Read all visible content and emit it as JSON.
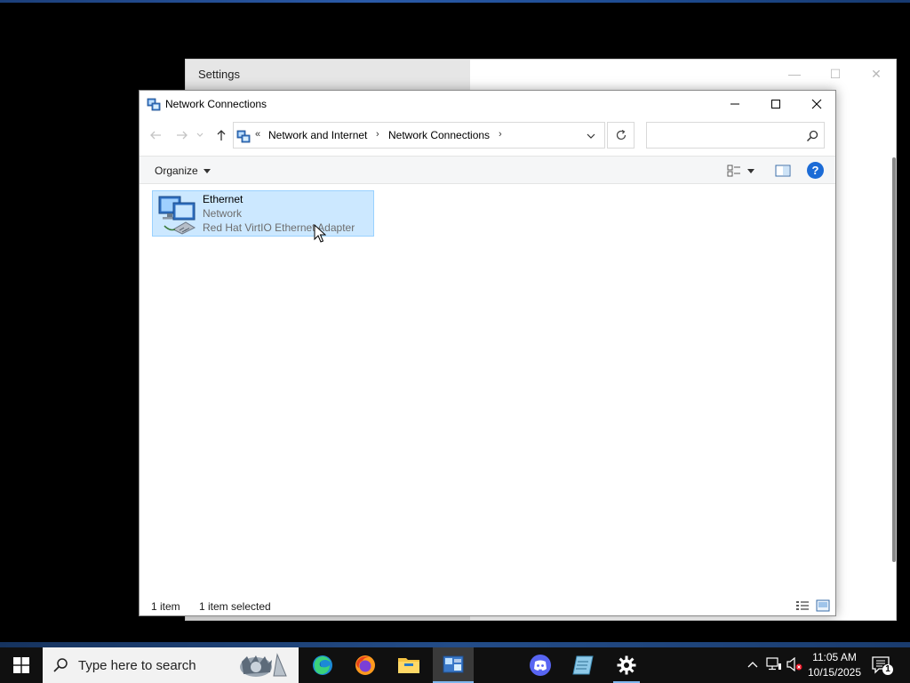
{
  "settings_window": {
    "title": "Settings",
    "controls": {
      "minimize": "—",
      "maximize": "☐",
      "close": "✕"
    }
  },
  "explorer": {
    "title": "Network Connections",
    "breadcrumb": {
      "overflow": "«",
      "items": [
        "Network and Internet",
        "Network Connections"
      ],
      "separator": "›"
    },
    "search": {
      "placeholder": ""
    },
    "toolbar": {
      "organize_label": "Organize",
      "help": "?"
    },
    "items": [
      {
        "name": "Ethernet",
        "status": "Network",
        "device": "Red Hat VirtIO Ethernet Adapter",
        "selected": true
      }
    ],
    "status": {
      "item_count": "1 item",
      "selection": "1 item selected"
    }
  },
  "taskbar": {
    "search_placeholder": "Type here to search",
    "apps": [
      "edge-icon",
      "firefox-icon",
      "file-explorer-icon",
      "network-connections-icon",
      "discord-icon",
      "notepad-icon",
      "settings-icon"
    ],
    "clock": {
      "time": "11:05 AM",
      "date": "10/15/2025"
    },
    "notification_count": "1"
  },
  "colors": {
    "selection_bg": "#cce8ff",
    "selection_border": "#99d1ff",
    "accent": "#1b6bd6",
    "taskbar": "#101010"
  }
}
